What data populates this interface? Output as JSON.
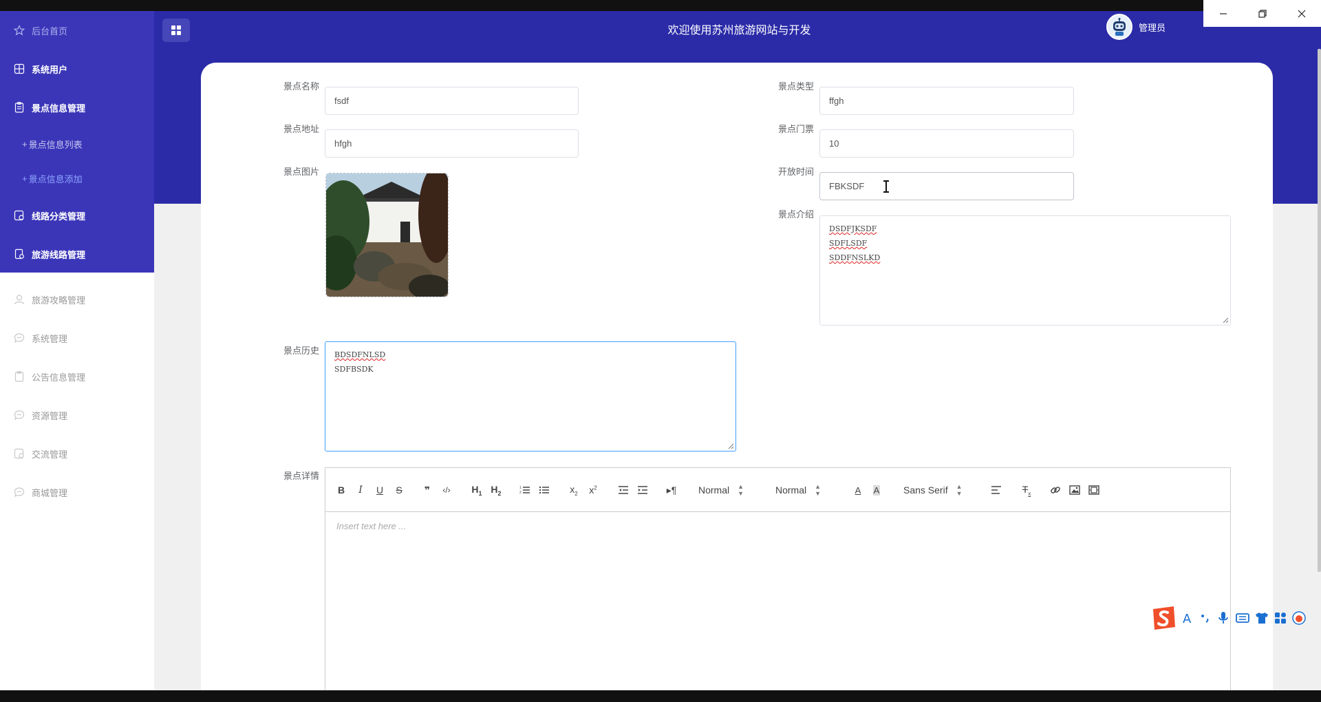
{
  "window": {
    "controls": [
      "minimize",
      "restore",
      "close"
    ]
  },
  "header": {
    "title": "欢迎使用苏州旅游网站与开发",
    "user_name": "管理员"
  },
  "sidebar": {
    "items": [
      {
        "label": "后台首页",
        "icon": "star-icon"
      },
      {
        "label": "系统用户",
        "icon": "grid-icon"
      },
      {
        "label": "景点信息管理",
        "icon": "clipboard-icon"
      },
      {
        "label": "线路分类管理",
        "icon": "route-icon"
      },
      {
        "label": "旅游线路管理",
        "icon": "route-icon"
      },
      {
        "label": "旅游攻略管理",
        "icon": "user-icon"
      },
      {
        "label": "系统管理",
        "icon": "chat-icon"
      },
      {
        "label": "公告信息管理",
        "icon": "clipboard-icon"
      },
      {
        "label": "资源管理",
        "icon": "chat-icon"
      },
      {
        "label": "交流管理",
        "icon": "route-icon"
      },
      {
        "label": "商城管理",
        "icon": "chat-icon"
      }
    ],
    "subitems": [
      {
        "label": "景点信息列表",
        "active": false
      },
      {
        "label": "景点信息添加",
        "active": true
      }
    ]
  },
  "form": {
    "name_label": "景点名称",
    "name_value": "fsdf",
    "type_label": "景点类型",
    "type_value": "ffgh",
    "address_label": "景点地址",
    "address_value": "hfgh",
    "ticket_label": "景点门票",
    "ticket_value": "10",
    "image_label": "景点图片",
    "open_label": "开放时间",
    "open_value": "FBKSDF",
    "intro_label": "景点介绍",
    "intro_lines": [
      "DSDFJKSDF",
      "SDFLSDF",
      "SDDFNSLKD"
    ],
    "history_label": "景点历史",
    "history_lines": [
      "BDSDFNLSD",
      "SDFBSDK"
    ],
    "detail_label": "景点详情"
  },
  "editor": {
    "header_select": "Normal",
    "size_select": "Normal",
    "font_select": "Sans Serif",
    "placeholder": "Insert text here ..."
  },
  "colors": {
    "sidebar_active": "#3b36b8",
    "header": "#2b2ba8",
    "focus_border": "#409eff"
  }
}
